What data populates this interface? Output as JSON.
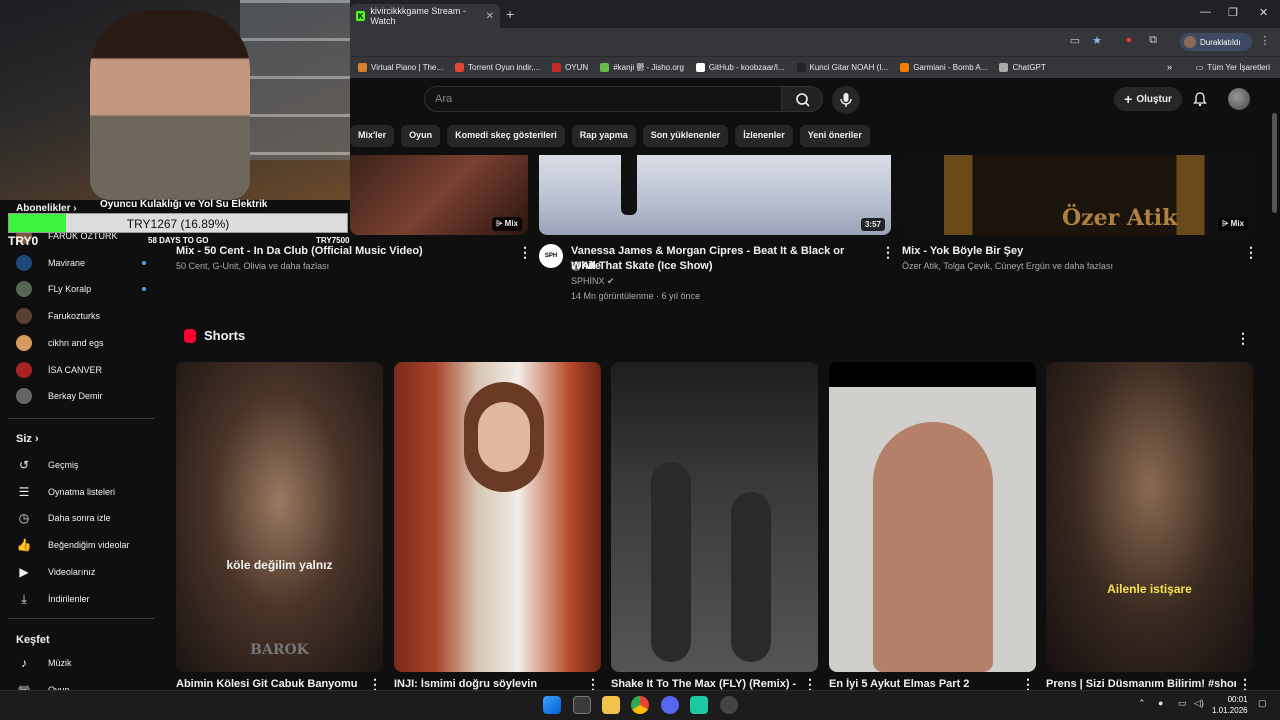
{
  "browser": {
    "tab_title": "kivircikkkgame Stream - Watch",
    "profile_label": "Duraklatıldı",
    "bookmarks": [
      {
        "label": "Virtual Piano | The...",
        "color": "#d9822b"
      },
      {
        "label": "Torrent Oyun indir,...",
        "color": "#e0463a"
      },
      {
        "label": "OYUN",
        "color": "#c62828"
      },
      {
        "label": "#kanji 鬱 - Jisho.org",
        "color": "#66bb44"
      },
      {
        "label": "GitHub - koobzaar/l...",
        "color": "#ffffff"
      },
      {
        "label": "Kunci Gitar NOAH (I...",
        "color": "#222222"
      },
      {
        "label": "Garmiani - Bomb A...",
        "color": "#f57c00"
      },
      {
        "label": "ChatGPT",
        "color": "#aaaaaa"
      }
    ],
    "all_bookmarks": "Tüm Yer İşaretleri"
  },
  "overlay": {
    "goal_title": "Oyuncu Kulaklığı ve Yol Su Elektrik",
    "goal_text": "TRY1267 (16.89%)",
    "goal_progress": 0.1689,
    "goal_left": "TRY0",
    "goal_days": "58 DAYS TO GO",
    "goal_right": "TRY7500"
  },
  "header": {
    "search_placeholder": "Ara",
    "create_label": "Oluştur"
  },
  "chips": [
    "Mix'ler",
    "Oyun",
    "Komedi skeç gösterileri",
    "Rap yapma",
    "Son yüklenenler",
    "İzlenenler",
    "Yeni öneriler"
  ],
  "sidebar": {
    "subscriptions_label": "Abonelikler",
    "subscriptions": [
      {
        "label": "FARUK ÖZTÜRK",
        "color": "#7a5a3a",
        "dot": false
      },
      {
        "label": "Mavirane",
        "color": "#1e4a7a",
        "dot": true
      },
      {
        "label": "FLy Koralp",
        "color": "#556655",
        "dot": true
      },
      {
        "label": "Farukozturks",
        "color": "#5a4030",
        "dot": false
      },
      {
        "label": "cikhn and egs",
        "color": "#d89a60",
        "dot": false
      },
      {
        "label": "İSA CANVER",
        "color": "#aa2222",
        "dot": false
      },
      {
        "label": "Berkay Demir",
        "color": "#666666",
        "dot": false
      }
    ],
    "you_label": "Siz",
    "you_items": [
      {
        "label": "Geçmiş",
        "icon": "history-icon",
        "glyph": "↺"
      },
      {
        "label": "Oynatma listeleri",
        "icon": "playlists-icon",
        "glyph": "☰"
      },
      {
        "label": "Daha sonra izle",
        "icon": "watch-later-icon",
        "glyph": "◷"
      },
      {
        "label": "Beğendiğim videolar",
        "icon": "like-icon",
        "glyph": "👍"
      },
      {
        "label": "Videolarınız",
        "icon": "your-videos-icon",
        "glyph": "▶"
      },
      {
        "label": "İndirilenler",
        "icon": "download-icon",
        "glyph": "⤓"
      }
    ],
    "explore_label": "Keşfet",
    "explore_items": [
      {
        "label": "Müzik",
        "icon": "music-icon",
        "glyph": "♪"
      },
      {
        "label": "Oyun",
        "icon": "gaming-icon",
        "glyph": "🎮"
      }
    ]
  },
  "videos": [
    {
      "title": "Mix - 50 Cent - In Da Club (Official Music Video)",
      "title2": "",
      "channel": "50 Cent, G-Unit, Olivia ve daha fazlası",
      "stats": "",
      "badge": "Mix"
    },
    {
      "title": "Vanessa James & Morgan Cipres - Beat It & Black or White",
      "title2": "@All That Skate (Ice Show)",
      "channel": "SPHİNX",
      "stats": "14 Mn görüntülenme · 6 yıl önce",
      "badge": "3:57"
    },
    {
      "title": "Mix - Yok Böyle Bir Şey",
      "title2": "",
      "channel": "Özer Atik, Tolga Çevik, Cüneyt Ergün ve daha fazlası",
      "stats": "",
      "badge": "Mix",
      "thumb_text": "Özer Atik"
    }
  ],
  "shorts": {
    "heading": "Shorts",
    "items": [
      {
        "title": "Abimin Kölesi Git Cabuk Banyomu",
        "caption": "köle değilim yalnız",
        "watermark": "BAROK"
      },
      {
        "title": "INJI: İsmimi doğru söylevin",
        "caption": ""
      },
      {
        "title": "Shake It To The Max (FLY) (Remix) -",
        "caption": ""
      },
      {
        "title": "En İyi 5 Aykut Elmas Part 2",
        "caption": ""
      },
      {
        "title": "Prens | Sizi Düsmanım Bilirim! #shorts",
        "caption": "Ailenle istişare"
      }
    ]
  },
  "taskbar": {
    "time": "00:01",
    "date": "1.01.2026"
  }
}
